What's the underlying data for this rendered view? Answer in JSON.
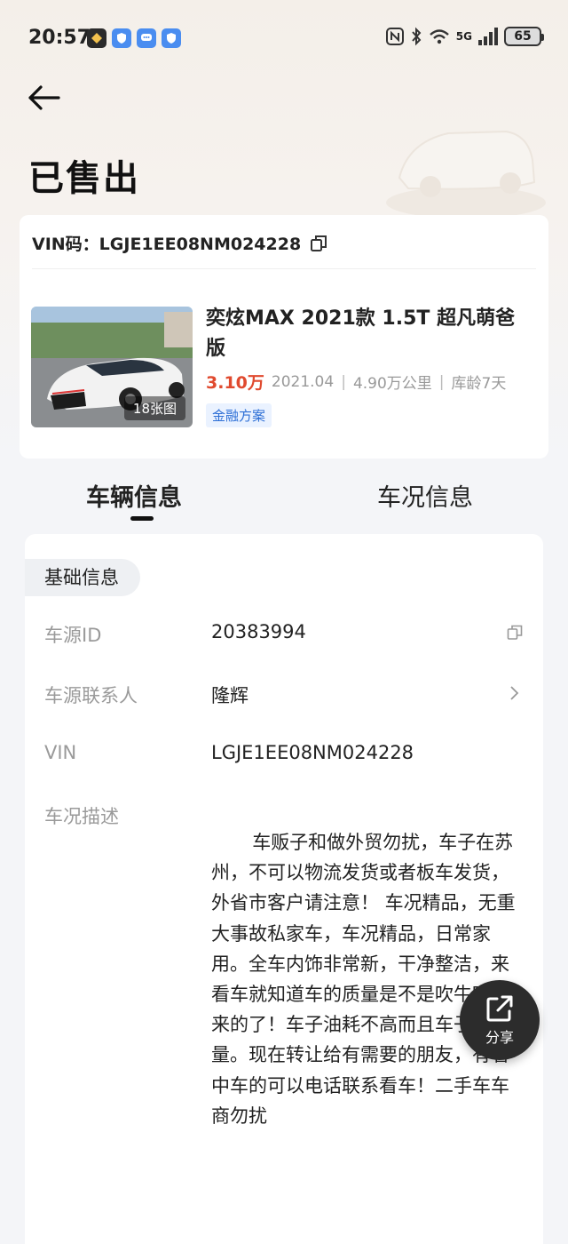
{
  "status_bar": {
    "time": "20:57",
    "network": "5G",
    "wifi_badge": "6",
    "battery": "65"
  },
  "header": {
    "title": "已售出"
  },
  "summary": {
    "vin_line": "VIN码：LGJE1EE08NM024228",
    "car_title": "奕炫MAX 2021款 1.5T 超凡萌爸版",
    "price": "3.10万",
    "reg_date": "2021.04",
    "mileage": "4.90万公里",
    "stock_age": "库龄7天",
    "photo_count": "18张图",
    "finance_tag": "金融方案"
  },
  "tabs": [
    {
      "label": "车辆信息",
      "active": true
    },
    {
      "label": "车况信息",
      "active": false
    }
  ],
  "details": {
    "section_title": "基础信息",
    "rows": [
      {
        "label": "车源ID",
        "value": "20383994"
      },
      {
        "label": "车源联系人",
        "value": "隆辉"
      },
      {
        "label": "VIN",
        "value": "LGJE1EE08NM024228"
      },
      {
        "label": "车况描述",
        "value": ""
      }
    ],
    "description": "车贩子和做外贸勿扰，车子在苏州，不可以物流发货或者板车发货，外省市客户请注意！ 车况精品，无重大事故私家车，车况精品，日常家用。全车内饰非常新，干净整洁，来看车就知道车的质量是不是吹牛吹出来的了！车子油耗不高而且车子高质量。现在转让给有需要的朋友，有看中车的可以电话联系看车！二手车车商勿扰"
  },
  "share": {
    "label": "分享"
  },
  "colors": {
    "price": "#e04a2f",
    "finance_tag_text": "#2d6fd6",
    "share_bg": "#2c2c2c"
  }
}
